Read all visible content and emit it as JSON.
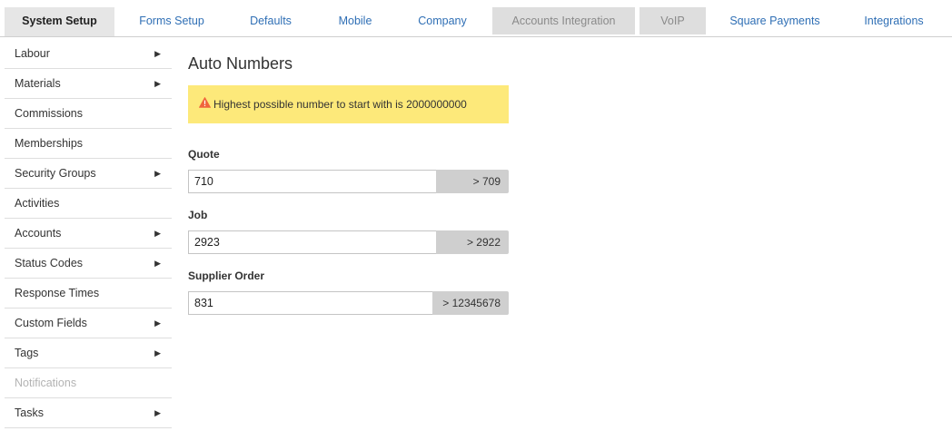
{
  "tabs": [
    {
      "label": "System Setup",
      "state": "active"
    },
    {
      "label": "Forms Setup",
      "state": "normal"
    },
    {
      "label": "Defaults",
      "state": "normal"
    },
    {
      "label": "Mobile",
      "state": "normal"
    },
    {
      "label": "Company",
      "state": "normal"
    },
    {
      "label": "Accounts Integration",
      "state": "disabled"
    },
    {
      "label": "VoIP",
      "state": "disabled"
    },
    {
      "label": "Square Payments",
      "state": "normal"
    },
    {
      "label": "Integrations",
      "state": "normal"
    }
  ],
  "sidebar": {
    "items": [
      {
        "label": "Labour",
        "has_submenu": true
      },
      {
        "label": "Materials",
        "has_submenu": true
      },
      {
        "label": "Commissions",
        "has_submenu": false
      },
      {
        "label": "Memberships",
        "has_submenu": false
      },
      {
        "label": "Security Groups",
        "has_submenu": true
      },
      {
        "label": "Activities",
        "has_submenu": false
      },
      {
        "label": "Accounts",
        "has_submenu": true
      },
      {
        "label": "Status Codes",
        "has_submenu": true
      },
      {
        "label": "Response Times",
        "has_submenu": false
      },
      {
        "label": "Custom Fields",
        "has_submenu": true
      },
      {
        "label": "Tags",
        "has_submenu": true
      },
      {
        "label": "Notifications",
        "has_submenu": false,
        "disabled": true
      },
      {
        "label": "Tasks",
        "has_submenu": true
      }
    ],
    "submenu_arrow": "▶"
  },
  "main": {
    "title": "Auto Numbers",
    "alert": {
      "icon": "warning-icon",
      "text": "Highest possible number to start with is 2000000000"
    },
    "fields": [
      {
        "label": "Quote",
        "value": "710",
        "min_hint": "> 709"
      },
      {
        "label": "Job",
        "value": "2923",
        "min_hint": "> 2922"
      },
      {
        "label": "Supplier Order",
        "value": "831",
        "min_hint": "> 12345678"
      }
    ]
  },
  "colors": {
    "tab_link": "#2f6fb5",
    "tab_active_bg": "#e6e6e6",
    "tab_disabled_bg": "#dedede",
    "alert_bg": "#fde97a",
    "warning_icon": "#f0643c",
    "addon_bg": "#cfcfcf"
  }
}
